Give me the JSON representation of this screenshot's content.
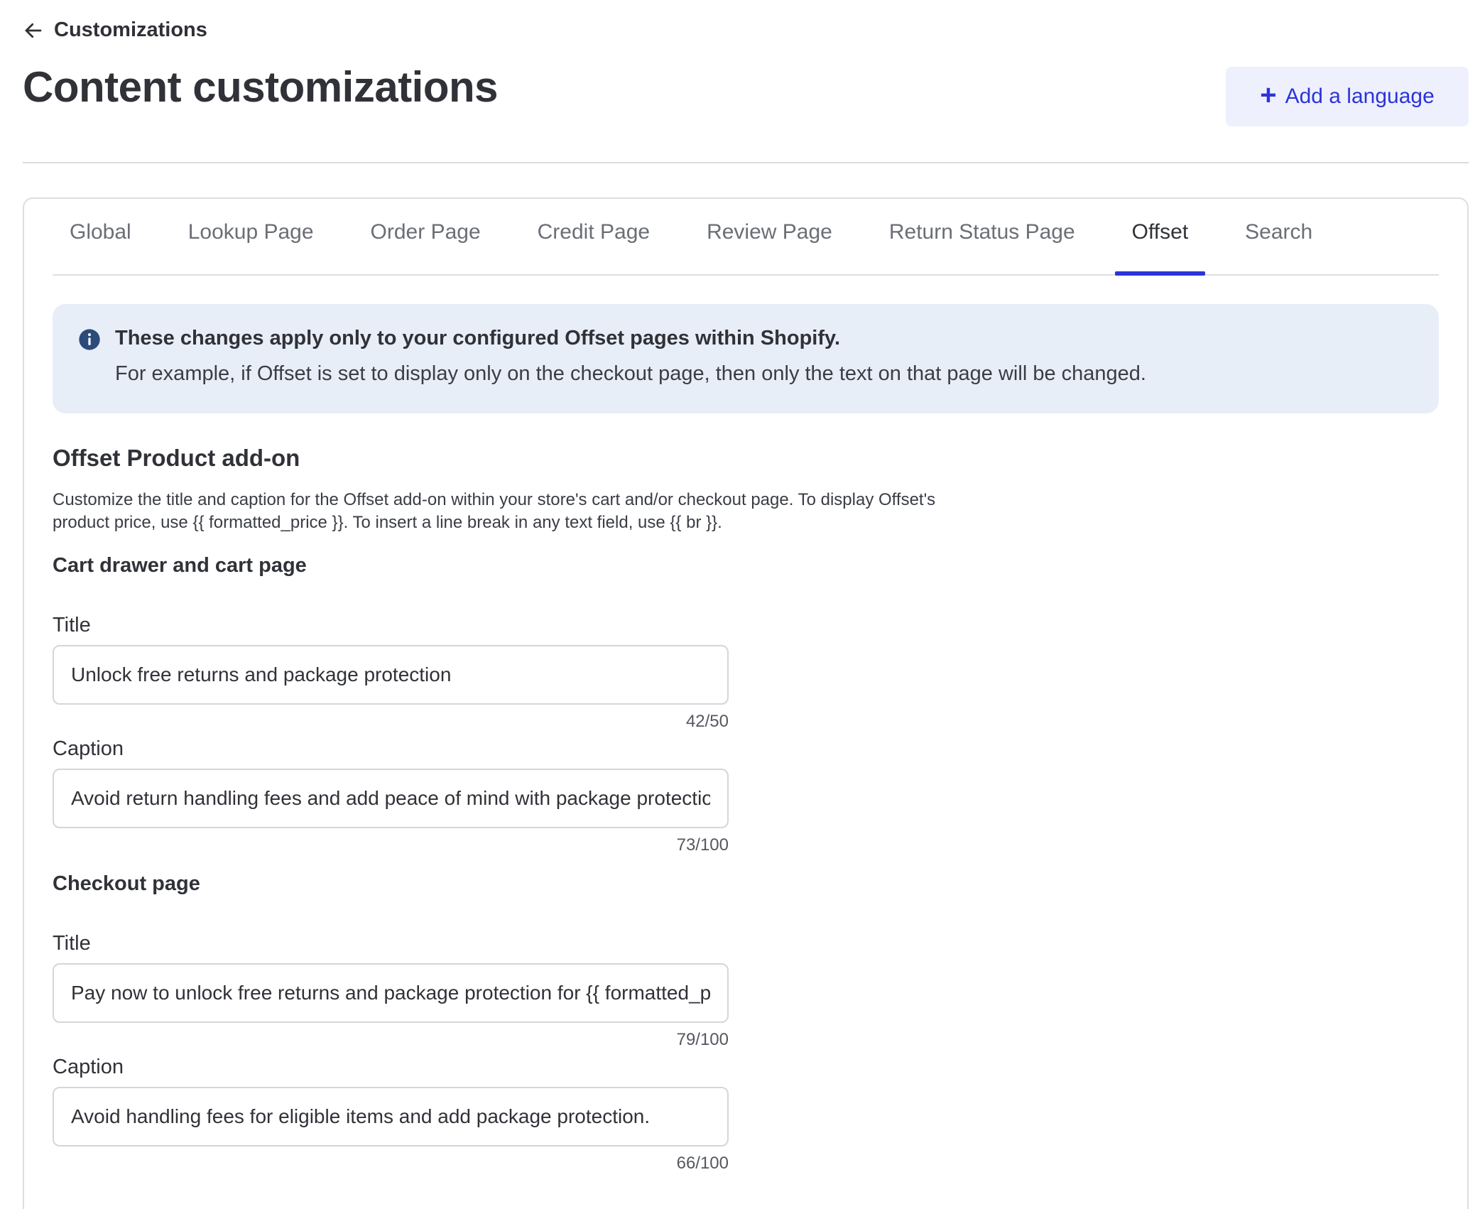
{
  "header": {
    "back_label": "Customizations",
    "title": "Content customizations",
    "add_language_label": "Add a language"
  },
  "tabs": [
    {
      "label": "Global",
      "active": false
    },
    {
      "label": "Lookup Page",
      "active": false
    },
    {
      "label": "Order Page",
      "active": false
    },
    {
      "label": "Credit Page",
      "active": false
    },
    {
      "label": "Review Page",
      "active": false
    },
    {
      "label": "Return Status Page",
      "active": false
    },
    {
      "label": "Offset",
      "active": true
    },
    {
      "label": "Search",
      "active": false
    }
  ],
  "banner": {
    "title": "These changes apply only to your configured Offset pages within Shopify.",
    "body": "For example, if Offset is set to display only on the checkout page, then only the text on that page will be changed."
  },
  "section": {
    "title": "Offset Product add-on",
    "desc_line1": "Customize the title and caption for the Offset add-on within your store's cart and/or checkout page. To display Offset's",
    "desc_line2": "product price, use {{ formatted_price }}. To insert a line break in any text field, use {{ br }}."
  },
  "cart": {
    "heading": "Cart drawer and cart page",
    "title_label": "Title",
    "title_value": "Unlock free returns and package protection",
    "title_count": "42/50",
    "caption_label": "Caption",
    "caption_value": "Avoid return handling fees and add peace of mind with package protection.",
    "caption_count": "73/100"
  },
  "checkout": {
    "heading": "Checkout page",
    "title_label": "Title",
    "title_value": "Pay now to unlock free returns and package protection for {{ formatted_price }}",
    "title_count": "79/100",
    "caption_label": "Caption",
    "caption_value": "Avoid handling fees for eligible items and add package protection.",
    "caption_count": "66/100"
  },
  "colors": {
    "accent": "#2b34d8",
    "banner_bg": "#e8eef8",
    "info_icon": "#2c4a7a"
  },
  "icons": {
    "back": "arrow-left-icon",
    "add": "plus-icon",
    "info": "info-circle-icon"
  }
}
